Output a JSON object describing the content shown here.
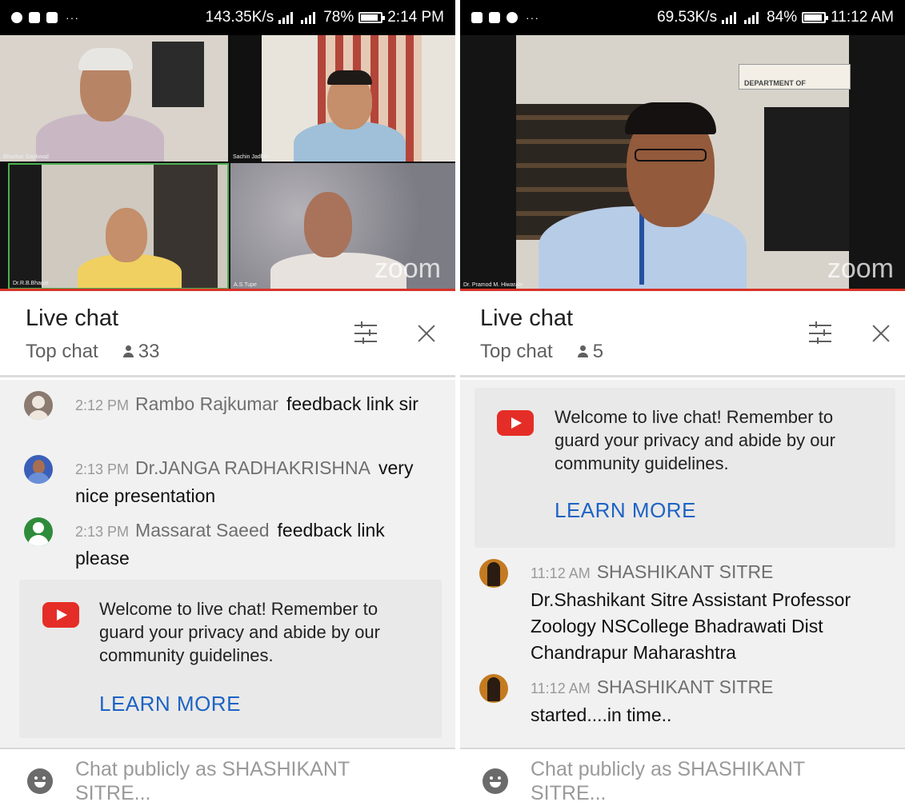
{
  "left": {
    "status": {
      "speed": "143.35K/s",
      "net1": "4G",
      "net2": "3G",
      "battery": "78%",
      "battery_level": 0.78,
      "time": "2:14 PM"
    },
    "video": {
      "tiles": [
        "Bhaskar Gaykwad",
        "Sachin Jadhav",
        "Dr.R.B.Bhagat",
        "A.S.Tupe"
      ],
      "watermark": "zoom"
    },
    "chat": {
      "title": "Live chat",
      "mode": "Top chat",
      "viewers": "33",
      "messages": [
        {
          "time": "2:12 PM",
          "author": "Rambo Rajkumar",
          "text": "feedback link sir"
        },
        {
          "time": "2:13 PM",
          "author": "Dr.JANGA RADHAKRISHNA",
          "text": "very nice presentation"
        },
        {
          "time": "2:13 PM",
          "author": "Massarat Saeed",
          "text": "feedback link please"
        }
      ],
      "welcome": "Welcome to live chat! Remember to guard your privacy and abide by our community guidelines.",
      "learn_more": "LEARN MORE",
      "placeholder": "Chat publicly as SHASHIKANT SITRE..."
    }
  },
  "right": {
    "status": {
      "speed": "69.53K/s",
      "net1": "4G",
      "net2": "3G",
      "battery": "84%",
      "battery_level": 0.84,
      "time": "11:12 AM"
    },
    "video": {
      "tiles": [
        "Dr. Pramod M. Hiwarale"
      ],
      "sign": "DEPARTMENT OF",
      "watermark": "zoom"
    },
    "chat": {
      "title": "Live chat",
      "mode": "Top chat",
      "viewers": "5",
      "welcome": "Welcome to live chat! Remember to guard your privacy and abide by our community guidelines.",
      "learn_more": "LEARN MORE",
      "messages": [
        {
          "time": "11:12 AM",
          "author": "SHASHIKANT SITRE",
          "text": "Dr.Shashikant Sitre Assistant Professor Zoology NSCollege Bhadrawati Dist Chandrapur Maharashtra"
        },
        {
          "time": "11:12 AM",
          "author": "SHASHIKANT SITRE",
          "text": "started....in time.."
        }
      ],
      "placeholder": "Chat publicly as SHASHIKANT SITRE..."
    }
  }
}
